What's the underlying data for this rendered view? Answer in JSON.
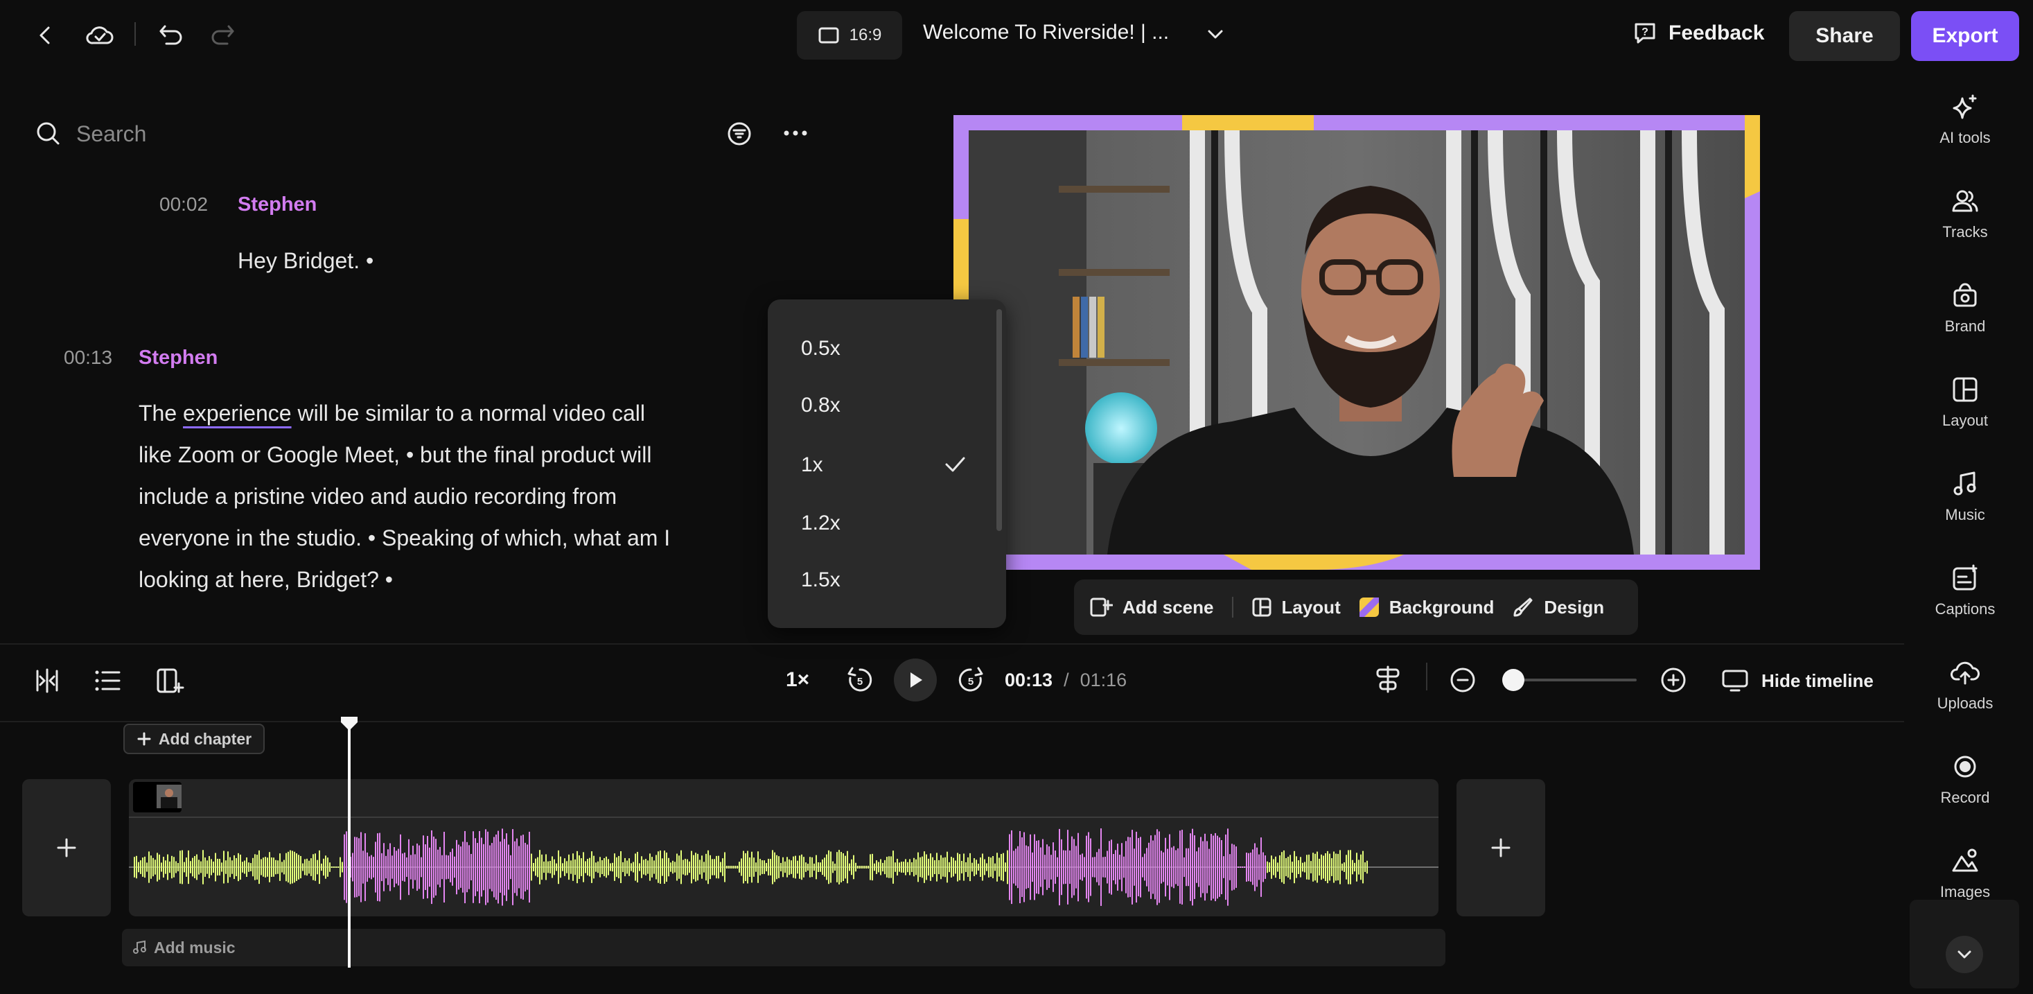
{
  "topbar": {
    "aspect_label": "16:9",
    "project_title": "Welcome To Riverside! | ...",
    "feedback_label": "Feedback",
    "share_label": "Share",
    "export_label": "Export"
  },
  "transcript": {
    "search_placeholder": "Search",
    "blocks": [
      {
        "time": "00:02",
        "speaker": "Stephen",
        "text": "Hey Bridget. •"
      },
      {
        "time": "00:13",
        "speaker": "Stephen",
        "line1_pre": "The ",
        "line1_word": "experience",
        "line1_post": " will be similar to a normal video call",
        "line2": "like Zoom or Google Meet, • but the final product will",
        "line3": "include a pristine video and audio recording from",
        "line4": "everyone in the studio. • Speaking of which, what am I",
        "line5": "looking at here, Bridget? •"
      }
    ]
  },
  "speed_menu": {
    "options": [
      "0.5x",
      "0.8x",
      "1x",
      "1.2x",
      "1.5x"
    ],
    "selected": "1x"
  },
  "scene_toolbar": {
    "add_scene": "Add scene",
    "layout": "Layout",
    "background": "Background",
    "design": "Design"
  },
  "rail": {
    "items": [
      "AI tools",
      "Tracks",
      "Brand",
      "Layout",
      "Music",
      "Captions",
      "Uploads",
      "Record",
      "Images"
    ]
  },
  "controls": {
    "speed": "1×",
    "current_time": "00:13",
    "separator": "/",
    "total_time": "01:16",
    "hide_timeline": "Hide timeline",
    "zoom_level": 0.05
  },
  "timeline": {
    "add_chapter": "Add chapter",
    "add_music": "Add music",
    "playhead_time": "00:13"
  },
  "colors": {
    "accent": "#7b4ff5",
    "speaker": "#d27cf0",
    "wave_green": "#e4ff7a",
    "wave_pink": "#e386f0",
    "frame_purple": "#b687f4",
    "frame_yellow": "#f5c842"
  }
}
